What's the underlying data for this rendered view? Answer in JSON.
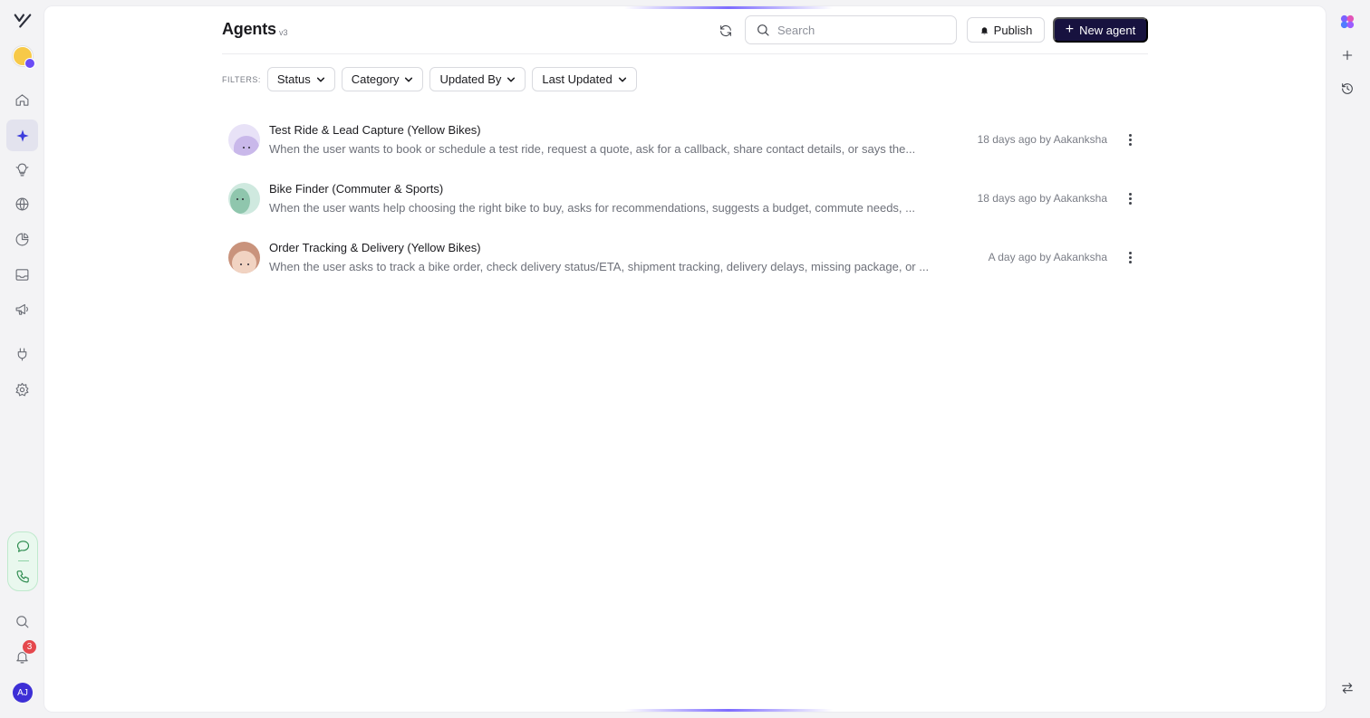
{
  "nav": {
    "items": [
      {
        "name": "home-icon"
      },
      {
        "name": "agents-icon",
        "active": true
      },
      {
        "name": "insights-icon"
      },
      {
        "name": "globe-icon"
      },
      {
        "name": "analytics-icon"
      },
      {
        "name": "inbox-icon"
      },
      {
        "name": "campaigns-icon"
      },
      {
        "name": "integrations-icon"
      },
      {
        "name": "settings-icon"
      }
    ],
    "notification_count": "3",
    "user_initials": "AJ"
  },
  "header": {
    "title": "Agents",
    "version": "v3",
    "search_placeholder": "Search",
    "publish_label": "Publish",
    "new_agent_label": "New agent"
  },
  "filters": {
    "label": "FILTERS:",
    "items": [
      "Status",
      "Category",
      "Updated By",
      "Last Updated"
    ]
  },
  "agents": [
    {
      "name": "Test Ride & Lead Capture (Yellow Bikes)",
      "description": "When the user wants to book or schedule a test ride, request a quote, ask for a callback, share contact details, or says the...",
      "updated": "18 days ago by Aakanksha",
      "avatar_bg": "#e8e2f7",
      "avatar_face": "#c9b8ea"
    },
    {
      "name": "Bike Finder (Commuter & Sports)",
      "description": "When the user wants help choosing the right bike to buy, asks for recommendations, suggests a budget, commute needs, ...",
      "updated": "18 days ago by Aakanksha",
      "avatar_bg": "#cfe9df",
      "avatar_face": "#8fc6ad"
    },
    {
      "name": "Order Tracking & Delivery (Yellow Bikes)",
      "description": "When the user asks to track a bike order, check delivery status/ETA, shipment tracking, delivery delays, missing package, or ...",
      "updated": "A day ago by Aakanksha",
      "avatar_bg": "#c9937c",
      "avatar_face": "#f1d3c2"
    }
  ],
  "colors": {
    "accent": "#3c3cdc",
    "primary_button": "#17123f",
    "notification_badge": "#e5484d"
  }
}
